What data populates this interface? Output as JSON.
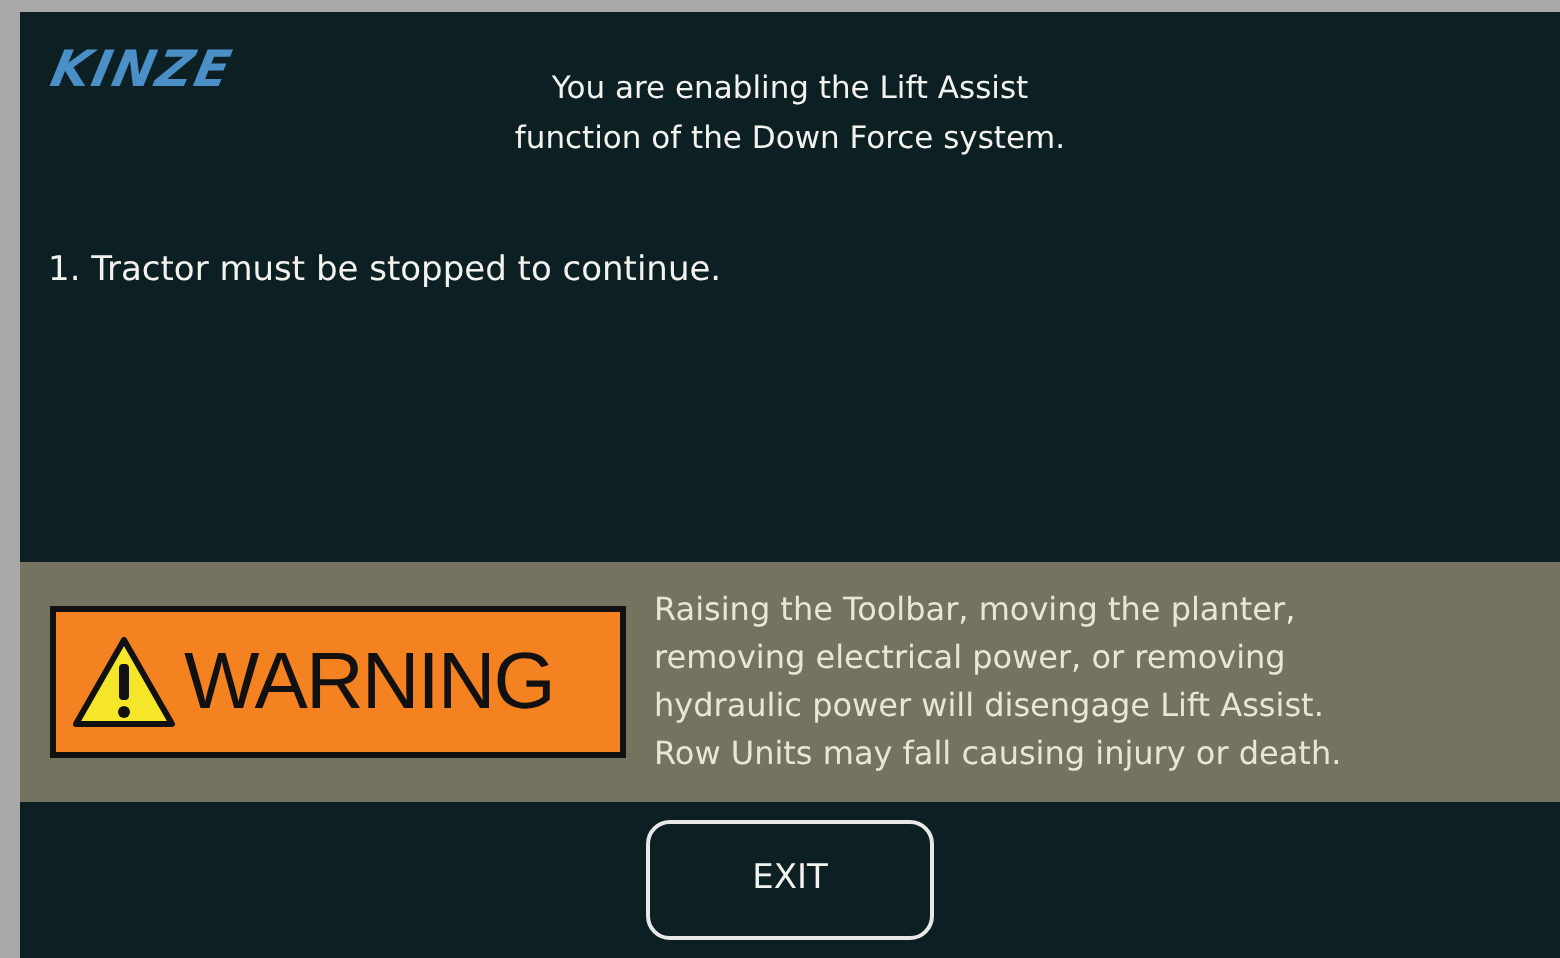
{
  "logo": {
    "text": "KINZE"
  },
  "title": {
    "lines": [
      "You are enabling the Lift Assist",
      "function of the Down Force system."
    ]
  },
  "steps": [
    "1. Tractor must be stopped to continue."
  ],
  "warning": {
    "label": "WARNING",
    "lines": [
      "Raising the Toolbar, moving the planter,",
      "removing electrical power, or removing",
      "hydraulic power will disengage Lift Assist.",
      "Row Units may fall causing injury or death."
    ]
  },
  "buttons": [
    "EXIT"
  ]
}
